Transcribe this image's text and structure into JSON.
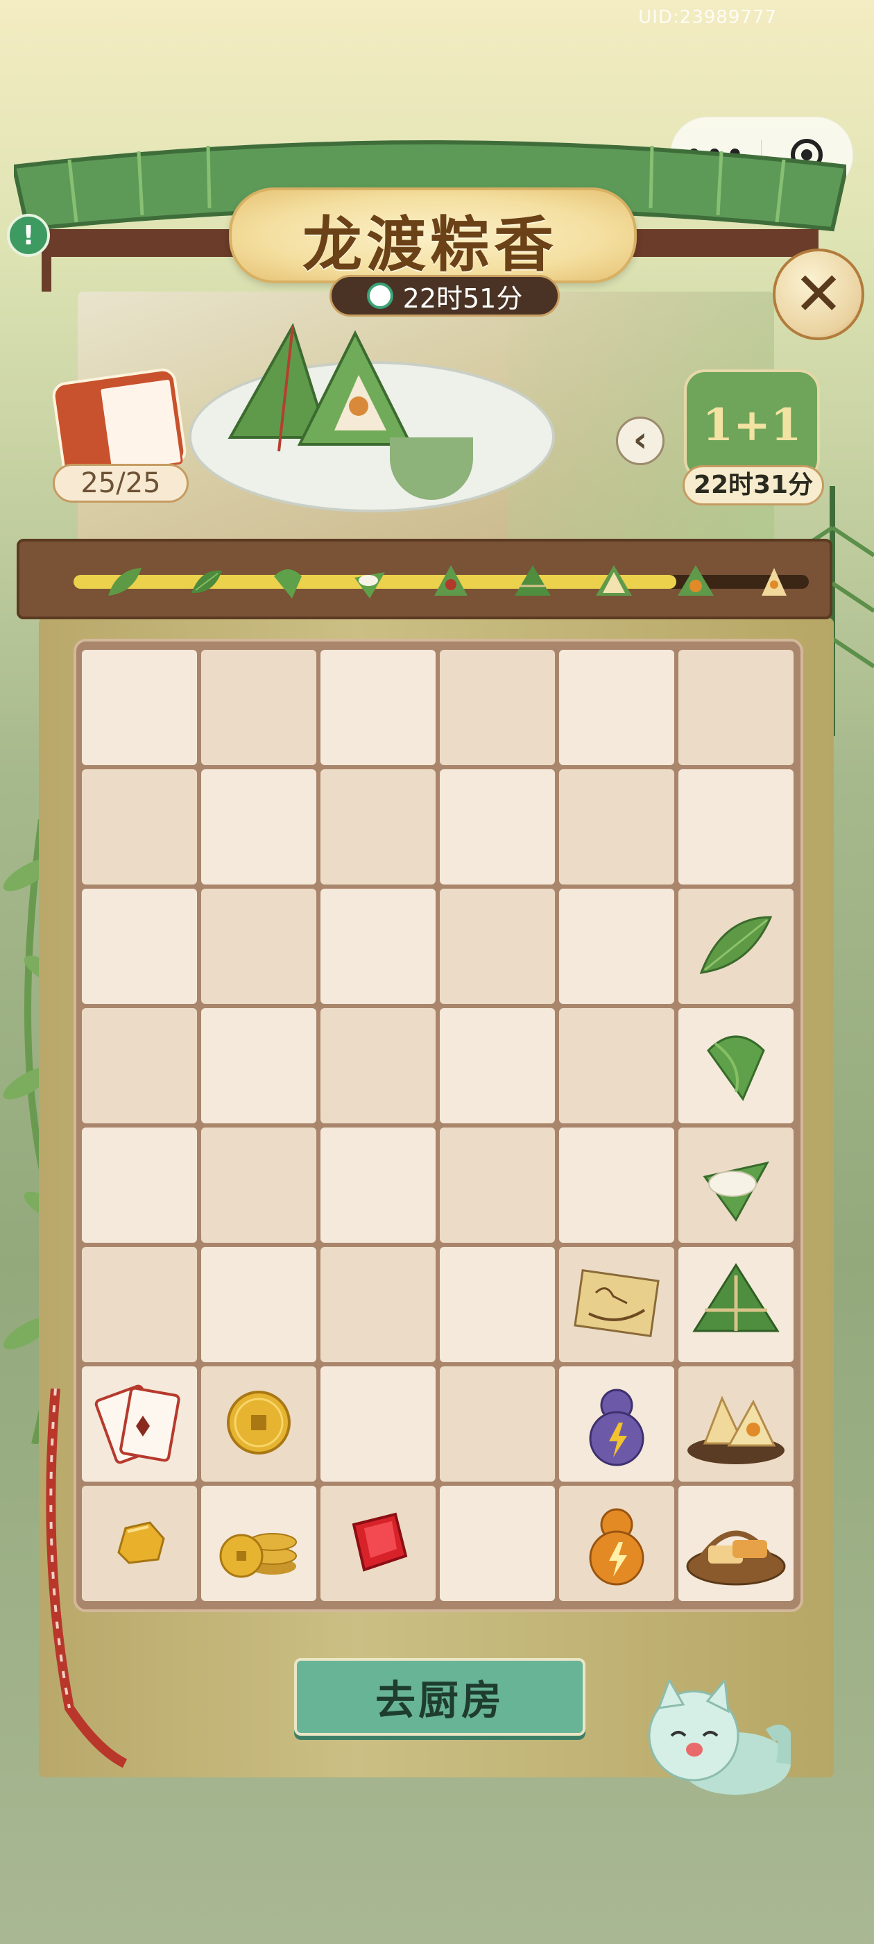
{
  "uid": "UID:23989777",
  "capsule": {
    "more": "•••"
  },
  "title": "龙渡粽香",
  "timer": "22时51分",
  "close_symbol": "✕",
  "tickets": {
    "count": "25/25"
  },
  "back_symbol": "‹",
  "event": {
    "label": "1+1",
    "timer": "22时31分"
  },
  "progress": {
    "fraction": 0.82,
    "steps": [
      "leaf",
      "leaf-2",
      "folded-leaf",
      "rice-leaf",
      "date-zongzi",
      "tied-zongzi",
      "yellow-zongzi",
      "egg-zongzi",
      "open-zongzi"
    ]
  },
  "board": {
    "rows": 8,
    "cols": 6,
    "items": [
      {
        "row": 2,
        "col": 5,
        "icon": "bamboo-leaf-icon"
      },
      {
        "row": 3,
        "col": 5,
        "icon": "folded-leaf-icon"
      },
      {
        "row": 4,
        "col": 5,
        "icon": "rice-cone-icon"
      },
      {
        "row": 5,
        "col": 4,
        "icon": "dragon-boat-scroll-icon"
      },
      {
        "row": 5,
        "col": 5,
        "icon": "tied-zongzi-icon"
      },
      {
        "row": 6,
        "col": 0,
        "icon": "cards-icon"
      },
      {
        "row": 6,
        "col": 1,
        "icon": "gold-coin-icon"
      },
      {
        "row": 6,
        "col": 4,
        "icon": "purple-energy-gourd-icon"
      },
      {
        "row": 6,
        "col": 5,
        "icon": "zongzi-plate-icon"
      },
      {
        "row": 7,
        "col": 0,
        "icon": "gold-nugget-icon"
      },
      {
        "row": 7,
        "col": 1,
        "icon": "coin-stack-icon"
      },
      {
        "row": 7,
        "col": 2,
        "icon": "red-gem-icon"
      },
      {
        "row": 7,
        "col": 4,
        "icon": "orange-energy-gourd-icon"
      },
      {
        "row": 7,
        "col": 5,
        "icon": "zongzi-basket-icon"
      }
    ]
  },
  "kitchen_button": "去厨房",
  "colors": {
    "accent_green": "#68b497",
    "wood": "#7a5236",
    "progress": "#ecd14d"
  }
}
